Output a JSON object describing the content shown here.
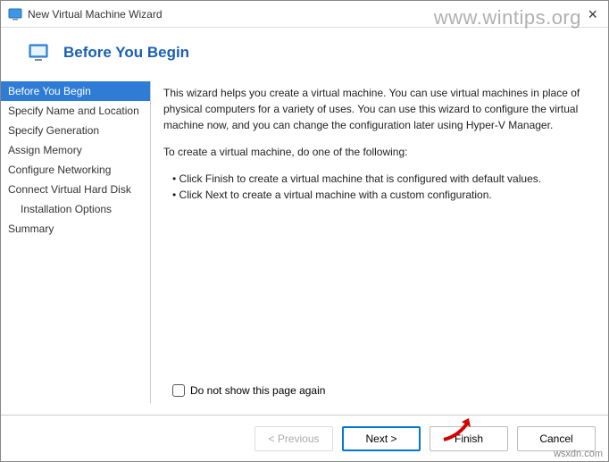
{
  "titlebar": {
    "title": "New Virtual Machine Wizard"
  },
  "watermark": "www.wintips.org",
  "watermark2": "wsxdn.com",
  "header": {
    "heading": "Before You Begin"
  },
  "sidebar": {
    "items": [
      {
        "label": "Before You Begin",
        "selected": true
      },
      {
        "label": "Specify Name and Location"
      },
      {
        "label": "Specify Generation"
      },
      {
        "label": "Assign Memory"
      },
      {
        "label": "Configure Networking"
      },
      {
        "label": "Connect Virtual Hard Disk"
      },
      {
        "label": "Installation Options",
        "indent": true
      },
      {
        "label": "Summary"
      }
    ]
  },
  "content": {
    "intro": "This wizard helps you create a virtual machine. You can use virtual machines in place of physical computers for a variety of uses. You can use this wizard to configure the virtual machine now, and you can change the configuration later using Hyper-V Manager.",
    "lead": "To create a virtual machine, do one of the following:",
    "bullet1": "Click Finish to create a virtual machine that is configured with default values.",
    "bullet2": "Click Next to create a virtual machine with a custom configuration.",
    "checkbox_label": "Do not show this page again"
  },
  "footer": {
    "previous": "< Previous",
    "next": "Next >",
    "finish": "Finish",
    "cancel": "Cancel"
  }
}
